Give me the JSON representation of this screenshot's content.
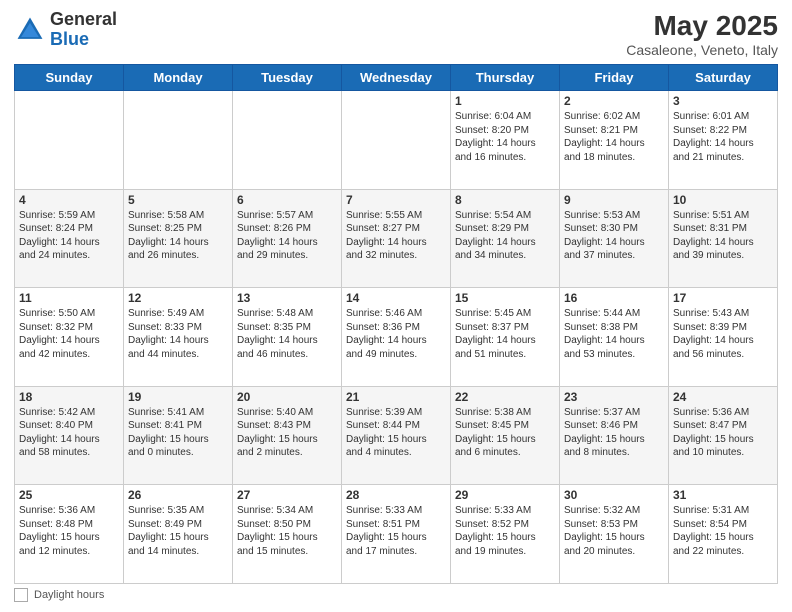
{
  "header": {
    "logo_general": "General",
    "logo_blue": "Blue",
    "month_year": "May 2025",
    "location": "Casaleone, Veneto, Italy"
  },
  "footer": {
    "daylight_label": "Daylight hours"
  },
  "weekdays": [
    "Sunday",
    "Monday",
    "Tuesday",
    "Wednesday",
    "Thursday",
    "Friday",
    "Saturday"
  ],
  "weeks": [
    [
      {
        "day": "",
        "info": ""
      },
      {
        "day": "",
        "info": ""
      },
      {
        "day": "",
        "info": ""
      },
      {
        "day": "",
        "info": ""
      },
      {
        "day": "1",
        "info": "Sunrise: 6:04 AM\nSunset: 8:20 PM\nDaylight: 14 hours\nand 16 minutes."
      },
      {
        "day": "2",
        "info": "Sunrise: 6:02 AM\nSunset: 8:21 PM\nDaylight: 14 hours\nand 18 minutes."
      },
      {
        "day": "3",
        "info": "Sunrise: 6:01 AM\nSunset: 8:22 PM\nDaylight: 14 hours\nand 21 minutes."
      }
    ],
    [
      {
        "day": "4",
        "info": "Sunrise: 5:59 AM\nSunset: 8:24 PM\nDaylight: 14 hours\nand 24 minutes."
      },
      {
        "day": "5",
        "info": "Sunrise: 5:58 AM\nSunset: 8:25 PM\nDaylight: 14 hours\nand 26 minutes."
      },
      {
        "day": "6",
        "info": "Sunrise: 5:57 AM\nSunset: 8:26 PM\nDaylight: 14 hours\nand 29 minutes."
      },
      {
        "day": "7",
        "info": "Sunrise: 5:55 AM\nSunset: 8:27 PM\nDaylight: 14 hours\nand 32 minutes."
      },
      {
        "day": "8",
        "info": "Sunrise: 5:54 AM\nSunset: 8:29 PM\nDaylight: 14 hours\nand 34 minutes."
      },
      {
        "day": "9",
        "info": "Sunrise: 5:53 AM\nSunset: 8:30 PM\nDaylight: 14 hours\nand 37 minutes."
      },
      {
        "day": "10",
        "info": "Sunrise: 5:51 AM\nSunset: 8:31 PM\nDaylight: 14 hours\nand 39 minutes."
      }
    ],
    [
      {
        "day": "11",
        "info": "Sunrise: 5:50 AM\nSunset: 8:32 PM\nDaylight: 14 hours\nand 42 minutes."
      },
      {
        "day": "12",
        "info": "Sunrise: 5:49 AM\nSunset: 8:33 PM\nDaylight: 14 hours\nand 44 minutes."
      },
      {
        "day": "13",
        "info": "Sunrise: 5:48 AM\nSunset: 8:35 PM\nDaylight: 14 hours\nand 46 minutes."
      },
      {
        "day": "14",
        "info": "Sunrise: 5:46 AM\nSunset: 8:36 PM\nDaylight: 14 hours\nand 49 minutes."
      },
      {
        "day": "15",
        "info": "Sunrise: 5:45 AM\nSunset: 8:37 PM\nDaylight: 14 hours\nand 51 minutes."
      },
      {
        "day": "16",
        "info": "Sunrise: 5:44 AM\nSunset: 8:38 PM\nDaylight: 14 hours\nand 53 minutes."
      },
      {
        "day": "17",
        "info": "Sunrise: 5:43 AM\nSunset: 8:39 PM\nDaylight: 14 hours\nand 56 minutes."
      }
    ],
    [
      {
        "day": "18",
        "info": "Sunrise: 5:42 AM\nSunset: 8:40 PM\nDaylight: 14 hours\nand 58 minutes."
      },
      {
        "day": "19",
        "info": "Sunrise: 5:41 AM\nSunset: 8:41 PM\nDaylight: 15 hours\nand 0 minutes."
      },
      {
        "day": "20",
        "info": "Sunrise: 5:40 AM\nSunset: 8:43 PM\nDaylight: 15 hours\nand 2 minutes."
      },
      {
        "day": "21",
        "info": "Sunrise: 5:39 AM\nSunset: 8:44 PM\nDaylight: 15 hours\nand 4 minutes."
      },
      {
        "day": "22",
        "info": "Sunrise: 5:38 AM\nSunset: 8:45 PM\nDaylight: 15 hours\nand 6 minutes."
      },
      {
        "day": "23",
        "info": "Sunrise: 5:37 AM\nSunset: 8:46 PM\nDaylight: 15 hours\nand 8 minutes."
      },
      {
        "day": "24",
        "info": "Sunrise: 5:36 AM\nSunset: 8:47 PM\nDaylight: 15 hours\nand 10 minutes."
      }
    ],
    [
      {
        "day": "25",
        "info": "Sunrise: 5:36 AM\nSunset: 8:48 PM\nDaylight: 15 hours\nand 12 minutes."
      },
      {
        "day": "26",
        "info": "Sunrise: 5:35 AM\nSunset: 8:49 PM\nDaylight: 15 hours\nand 14 minutes."
      },
      {
        "day": "27",
        "info": "Sunrise: 5:34 AM\nSunset: 8:50 PM\nDaylight: 15 hours\nand 15 minutes."
      },
      {
        "day": "28",
        "info": "Sunrise: 5:33 AM\nSunset: 8:51 PM\nDaylight: 15 hours\nand 17 minutes."
      },
      {
        "day": "29",
        "info": "Sunrise: 5:33 AM\nSunset: 8:52 PM\nDaylight: 15 hours\nand 19 minutes."
      },
      {
        "day": "30",
        "info": "Sunrise: 5:32 AM\nSunset: 8:53 PM\nDaylight: 15 hours\nand 20 minutes."
      },
      {
        "day": "31",
        "info": "Sunrise: 5:31 AM\nSunset: 8:54 PM\nDaylight: 15 hours\nand 22 minutes."
      }
    ]
  ]
}
